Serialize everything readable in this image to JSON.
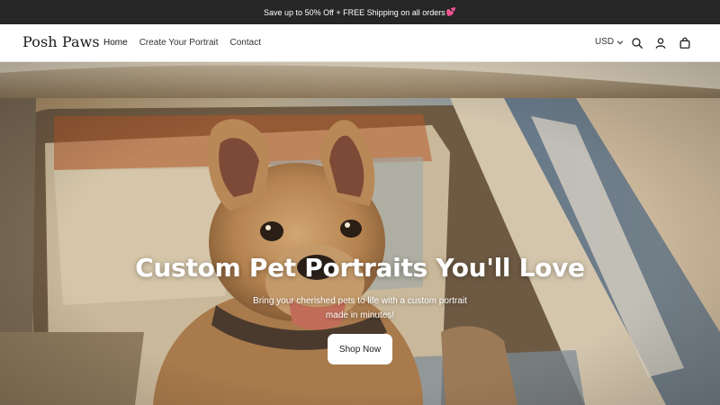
{
  "announcement": {
    "text": "Save up to 50% Off + FREE Shipping on all orders",
    "emoji": "💕"
  },
  "header": {
    "logo": "Posh Paws",
    "nav": [
      {
        "label": "Home"
      },
      {
        "label": "Create Your Portrait"
      },
      {
        "label": "Contact"
      }
    ],
    "currency": "USD",
    "icons": [
      "search-icon",
      "account-icon",
      "cart-icon"
    ]
  },
  "hero": {
    "title": "Custom Pet Portraits You'll Love",
    "subtitle": "Bring your cherished pets to life with a custom portrait made in minutes!",
    "cta": "Shop Now"
  },
  "colors": {
    "announcement_bg": "#262626",
    "button_bg": "#ffffff",
    "text": "#1a1a1a"
  }
}
